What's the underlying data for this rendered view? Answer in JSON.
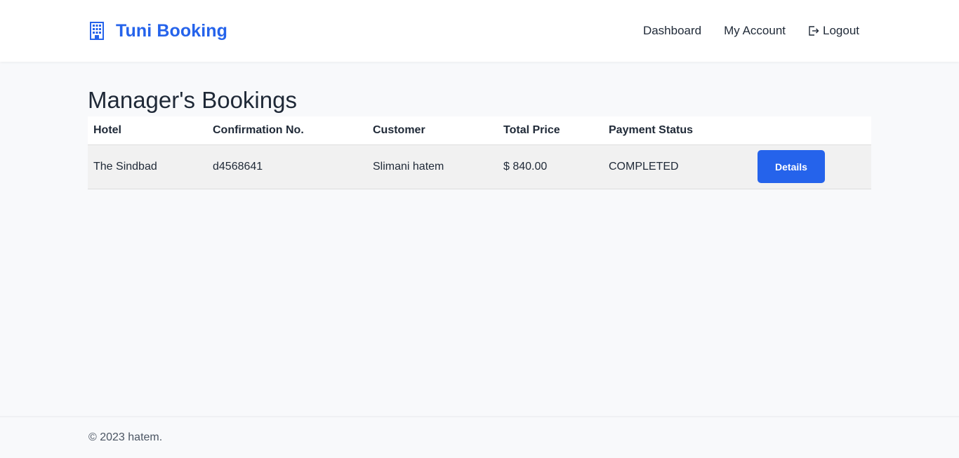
{
  "navbar": {
    "brand_icon": "building-icon",
    "brand_name": "Tuni Booking",
    "links": {
      "dashboard": "Dashboard",
      "account": "My Account",
      "logout": "Logout",
      "logout_icon": "logout-icon"
    }
  },
  "main": {
    "title": "Manager's Bookings",
    "table": {
      "columns": [
        "Hotel",
        "Confirmation No.",
        "Customer",
        "Total Price",
        "Payment Status",
        ""
      ],
      "rows": [
        {
          "hotel": "The Sindbad",
          "confirmation": "d4568641",
          "customer": "Slimani hatem",
          "total_price": "$ 840.00",
          "payment_status": "COMPLETED",
          "action_label": "Details"
        }
      ]
    }
  },
  "footer": {
    "text": "© 2023 hatem."
  },
  "colors": {
    "accent": "#2563eb",
    "background": "#f8f9fb",
    "text": "#1f2937"
  }
}
